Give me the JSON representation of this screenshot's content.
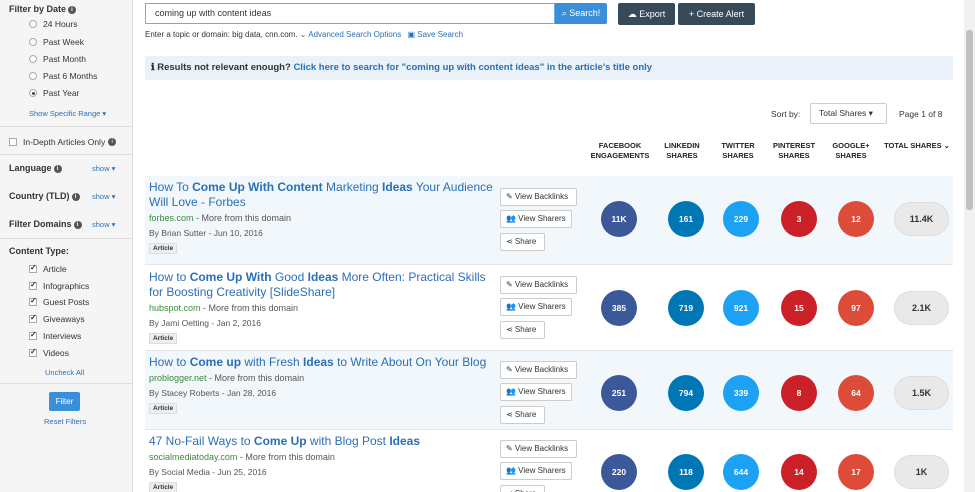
{
  "sidebar": {
    "filter_by_date": "Filter by Date",
    "date_options": [
      {
        "label": "24 Hours",
        "selected": false
      },
      {
        "label": "Past Week",
        "selected": false
      },
      {
        "label": "Past Month",
        "selected": false
      },
      {
        "label": "Past 6 Months",
        "selected": false
      },
      {
        "label": "Past Year",
        "selected": true
      }
    ],
    "show_specific_range": "Show Specific Range ▾",
    "in_depth": "In-Depth Articles Only",
    "language": "Language",
    "country": "Country (TLD)",
    "filter_domains": "Filter Domains",
    "show": "show ▾",
    "content_type": "Content Type:",
    "content_types": [
      {
        "label": "Article",
        "checked": true
      },
      {
        "label": "Infographics",
        "checked": true
      },
      {
        "label": "Guest Posts",
        "checked": true
      },
      {
        "label": "Giveaways",
        "checked": true
      },
      {
        "label": "Interviews",
        "checked": true
      },
      {
        "label": "Videos",
        "checked": true
      }
    ],
    "uncheck_all": "Uncheck All",
    "filter_button": "Filter",
    "reset_filters": "Reset Filters"
  },
  "search": {
    "value": "coming up with content ideas",
    "button": "Search!",
    "export": "Export",
    "create_alert": "Create Alert",
    "hint": "Enter a topic or domain: big data, cnn.com.",
    "advanced": "Advanced Search Options",
    "save": "Save Search"
  },
  "notice": {
    "prefix": "Results not relevant enough?",
    "link": "Click here to search for \"coming up with content ideas\" in the article's title only"
  },
  "sort": {
    "label": "Sort by:",
    "value": "Total Shares",
    "page": "Page 1 of 8"
  },
  "columns": [
    "FACEBOOK\nENGAGEMENTS",
    "LINKEDIN\nSHARES",
    "TWITTER\nSHARES",
    "PINTEREST\nSHARES",
    "GOOGLE+\nSHARES",
    "TOTAL SHARES"
  ],
  "actions": {
    "backlinks": "View Backlinks",
    "sharers": "View Sharers",
    "share": "Share"
  },
  "colors": {
    "facebook": "#3b5998",
    "linkedin": "#0077b5",
    "twitter": "#1da1f2",
    "pinterest": "#cb2027",
    "google": "#dd4b39",
    "accent": "#3a8fd9",
    "dark": "#374a59"
  },
  "results": [
    {
      "title_html": "How To <b>Come Up With Content</b> Marketing <b>Ideas</b> Your Audience Will Love - Forbes",
      "domain": "forbes.com",
      "more": "More from this domain",
      "byline": "By Brian Sutter - Jun 10, 2016",
      "tag": "Article",
      "facebook": "11K",
      "linkedin": "161",
      "twitter": "229",
      "pinterest": "3",
      "google": "12",
      "total": "11.4K"
    },
    {
      "title_html": "How to <b>Come Up With</b> Good <b>Ideas</b> More Often: Practical Skills for Boosting Creativity [SlideShare]",
      "domain": "hubspot.com",
      "more": "More from this domain",
      "byline": "By Jami Oetting - Jan 2, 2016",
      "tag": "Article",
      "facebook": "385",
      "linkedin": "719",
      "twitter": "921",
      "pinterest": "15",
      "google": "97",
      "total": "2.1K"
    },
    {
      "title_html": "How to <b>Come up</b> with Fresh <b>Ideas</b> to Write About On Your Blog",
      "domain": "problogger.net",
      "more": "More from this domain",
      "byline": "By Stacey Roberts - Jan 28, 2016",
      "tag": "Article",
      "facebook": "251",
      "linkedin": "794",
      "twitter": "339",
      "pinterest": "8",
      "google": "64",
      "total": "1.5K"
    },
    {
      "title_html": "47 No-Fail Ways to <b>Come Up</b> with Blog Post <b>Ideas</b>",
      "domain": "socialmediatoday.com",
      "more": "More from this domain",
      "byline": "By Social Media - Jun 25, 2016",
      "tag": "Article",
      "facebook": "220",
      "linkedin": "118",
      "twitter": "644",
      "pinterest": "14",
      "google": "17",
      "total": "1K"
    }
  ]
}
